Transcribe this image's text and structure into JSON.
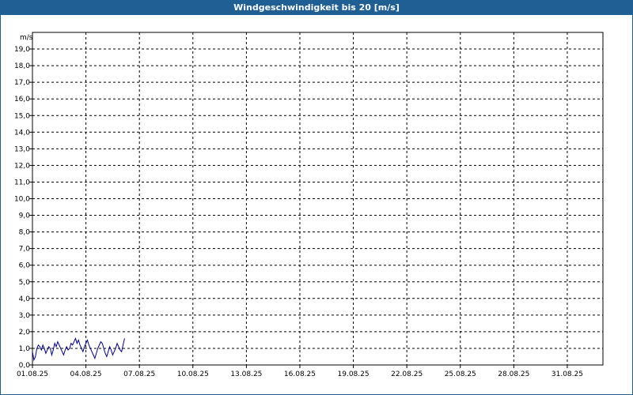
{
  "window": {
    "title": "Windgeschwindigkeit bis 20 [m/s]"
  },
  "chart_data": {
    "type": "line",
    "title": "Windgeschwindigkeit bis 20 [m/s]",
    "ylabel": "m/s",
    "ylim": [
      0,
      20
    ],
    "yticks": [
      "0,0",
      "1,0",
      "2,0",
      "3,0",
      "4,0",
      "5,0",
      "6,0",
      "7,0",
      "8,0",
      "9,0",
      "10,0",
      "11,0",
      "12,0",
      "13,0",
      "14,0",
      "15,0",
      "16,0",
      "17,0",
      "18,0",
      "19,0"
    ],
    "xlim": [
      "01.08.25",
      "02.09.25"
    ],
    "xticks": [
      "01.08.25",
      "04.08.25",
      "07.08.25",
      "10.08.25",
      "13.08.25",
      "16.08.25",
      "19.08.25",
      "22.08.25",
      "25.08.25",
      "28.08.25",
      "31.08.25"
    ],
    "grid": true,
    "line_color": "#00008b",
    "series": [
      {
        "x": [
          "01.08.25 00:00",
          "01.08.25 02:00",
          "01.08.25 04:00",
          "01.08.25 06:00",
          "01.08.25 08:00",
          "01.08.25 10:00",
          "01.08.25 12:00",
          "01.08.25 14:00",
          "01.08.25 16:00",
          "01.08.25 18:00",
          "01.08.25 20:00",
          "01.08.25 22:00",
          "02.08.25 00:00",
          "02.08.25 02:00",
          "02.08.25 04:00",
          "02.08.25 06:00",
          "02.08.25 08:00",
          "02.08.25 10:00",
          "02.08.25 12:00",
          "02.08.25 14:00",
          "02.08.25 16:00",
          "02.08.25 18:00",
          "02.08.25 20:00",
          "02.08.25 22:00",
          "03.08.25 00:00",
          "03.08.25 02:00",
          "03.08.25 04:00",
          "03.08.25 06:00",
          "03.08.25 08:00",
          "03.08.25 10:00",
          "03.08.25 12:00",
          "03.08.25 14:00",
          "03.08.25 16:00",
          "03.08.25 18:00",
          "03.08.25 20:00",
          "03.08.25 22:00",
          "04.08.25 00:00",
          "04.08.25 02:00",
          "04.08.25 04:00",
          "04.08.25 06:00",
          "04.08.25 08:00",
          "04.08.25 10:00",
          "04.08.25 12:00",
          "04.08.25 14:00",
          "04.08.25 16:00",
          "04.08.25 18:00",
          "04.08.25 20:00",
          "04.08.25 22:00",
          "05.08.25 00:00",
          "05.08.25 02:00",
          "05.08.25 04:00",
          "05.08.25 06:00",
          "05.08.25 08:00",
          "05.08.25 10:00",
          "05.08.25 12:00",
          "05.08.25 14:00",
          "05.08.25 16:00",
          "05.08.25 18:00",
          "05.08.25 20:00",
          "05.08.25 22:00",
          "06.08.25 00:00",
          "06.08.25 02:00",
          "06.08.25 04:00"
        ],
        "values": [
          0.8,
          0.3,
          0.5,
          1.0,
          1.2,
          1.1,
          0.9,
          1.2,
          1.0,
          0.7,
          0.9,
          1.1,
          1.0,
          0.6,
          0.9,
          1.3,
          1.1,
          1.4,
          1.2,
          1.0,
          0.8,
          0.6,
          0.9,
          1.1,
          0.9,
          1.0,
          1.3,
          1.2,
          1.4,
          1.6,
          1.3,
          1.5,
          1.2,
          1.0,
          0.8,
          1.1,
          1.3,
          1.5,
          1.2,
          1.0,
          0.8,
          0.6,
          0.4,
          0.7,
          1.0,
          1.2,
          1.4,
          1.3,
          1.0,
          0.7,
          0.5,
          0.8,
          1.1,
          0.9,
          0.6,
          0.8,
          1.0,
          1.3,
          1.1,
          0.9,
          0.8,
          1.2,
          1.6
        ]
      }
    ]
  }
}
